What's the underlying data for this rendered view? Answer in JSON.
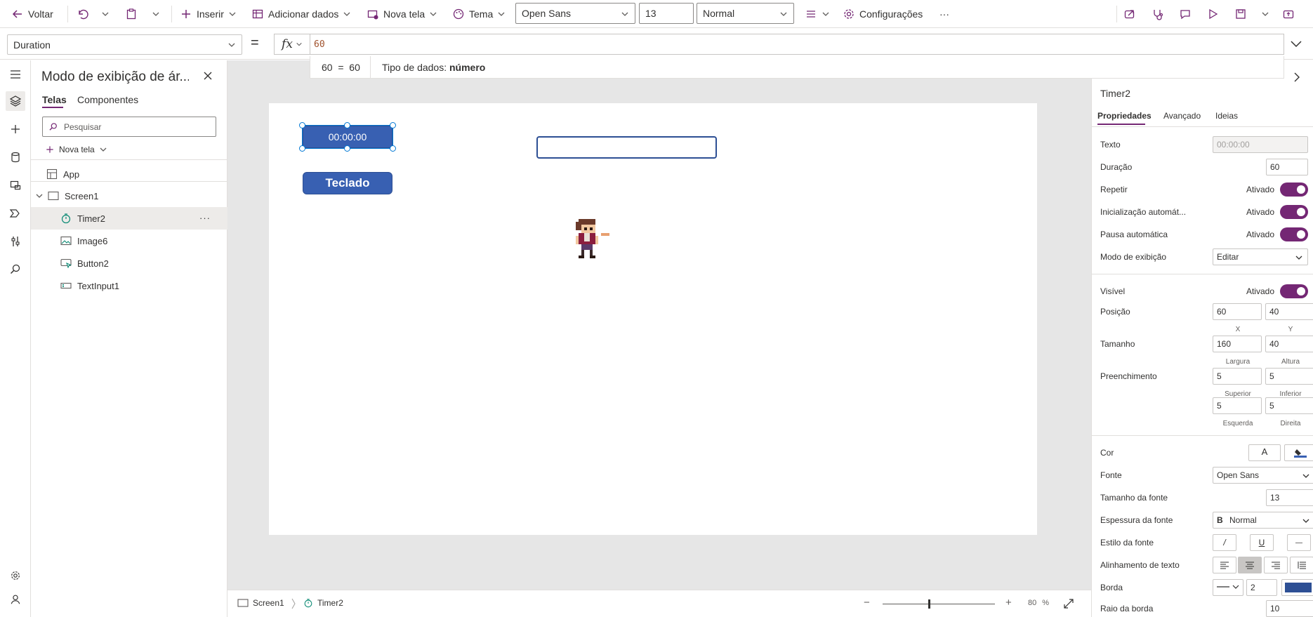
{
  "toolbar": {
    "back_label": "Voltar",
    "insert_label": "Inserir",
    "add_data_label": "Adicionar dados",
    "new_screen_label": "Nova tela",
    "theme_label": "Tema",
    "font_value": "Open Sans",
    "font_size_value": "13",
    "font_weight_value": "Normal",
    "settings_label": "Configurações",
    "more_label": "···"
  },
  "formula_bar": {
    "property": "Duration",
    "equals": "=",
    "fx": "fx",
    "formula": "60",
    "result_expr": "60  =  60",
    "data_type_label": "Tipo de dados:",
    "data_type_value": "número"
  },
  "tree_view": {
    "title": "Modo de exibição de ár...",
    "tabs": [
      "Telas",
      "Componentes"
    ],
    "search_placeholder": "Pesquisar",
    "new_screen_label": "Nova tela",
    "app_label": "App",
    "screen_label": "Screen1",
    "items": [
      {
        "label": "Timer2",
        "icon": "timer-icon",
        "selected": true
      },
      {
        "label": "Image6",
        "icon": "image-icon",
        "selected": false
      },
      {
        "label": "Button2",
        "icon": "button-icon",
        "selected": false
      },
      {
        "label": "TextInput1",
        "icon": "text-input-icon",
        "selected": false
      }
    ],
    "more": "···"
  },
  "canvas": {
    "timer_text": "00:00:00",
    "button_text": "Teclado"
  },
  "status_bar": {
    "screen_crumb": "Screen1",
    "control_crumb": "Timer2",
    "zoom_value": "80",
    "zoom_unit": "%",
    "zoom_minus": "−",
    "zoom_plus": "+"
  },
  "properties": {
    "control_name": "Timer2",
    "tabs": [
      "Propriedades",
      "Avançado",
      "Ideias"
    ],
    "text_label": "Texto",
    "text_value": "00:00:00",
    "duration_label": "Duração",
    "duration_value": "60",
    "repeat_label": "Repetir",
    "autostart_label": "Inicialização automát...",
    "autopause_label": "Pausa automática",
    "on_label": "Ativado",
    "display_mode_label": "Modo de exibição",
    "display_mode_value": "Editar",
    "visible_label": "Visível",
    "position_label": "Posição",
    "position_x": "60",
    "position_y": "40",
    "x_label": "X",
    "y_label": "Y",
    "size_label": "Tamanho",
    "width_value": "160",
    "height_value": "40",
    "width_label": "Largura",
    "height_label": "Altura",
    "padding_label": "Preenchimento",
    "padding_top": "5",
    "padding_bottom": "5",
    "padding_left": "5",
    "padding_right": "5",
    "top_label": "Superior",
    "bottom_label": "Inferior",
    "left_label": "Esquerda",
    "right_label": "Direita",
    "color_label": "Cor",
    "color_text_glyph": "A",
    "font_label": "Fonte",
    "font_value": "Open Sans",
    "font_size_label": "Tamanho da fonte",
    "font_size_value": "13",
    "font_weight_label": "Espessura da fonte",
    "font_weight_glyph": "B",
    "font_weight_value": "Normal",
    "font_style_label": "Estilo da fonte",
    "italic_glyph": "/",
    "underline_glyph": "U",
    "strike_glyph": "—",
    "text_align_label": "Alinhamento de texto",
    "border_label": "Borda",
    "border_width_value": "2",
    "radius_label": "Raio da borda",
    "radius_value": "10"
  },
  "colors": {
    "accent": "#742774",
    "control_fill": "#3860b2",
    "control_border": "#2d4f94",
    "selection": "#0078d4"
  }
}
